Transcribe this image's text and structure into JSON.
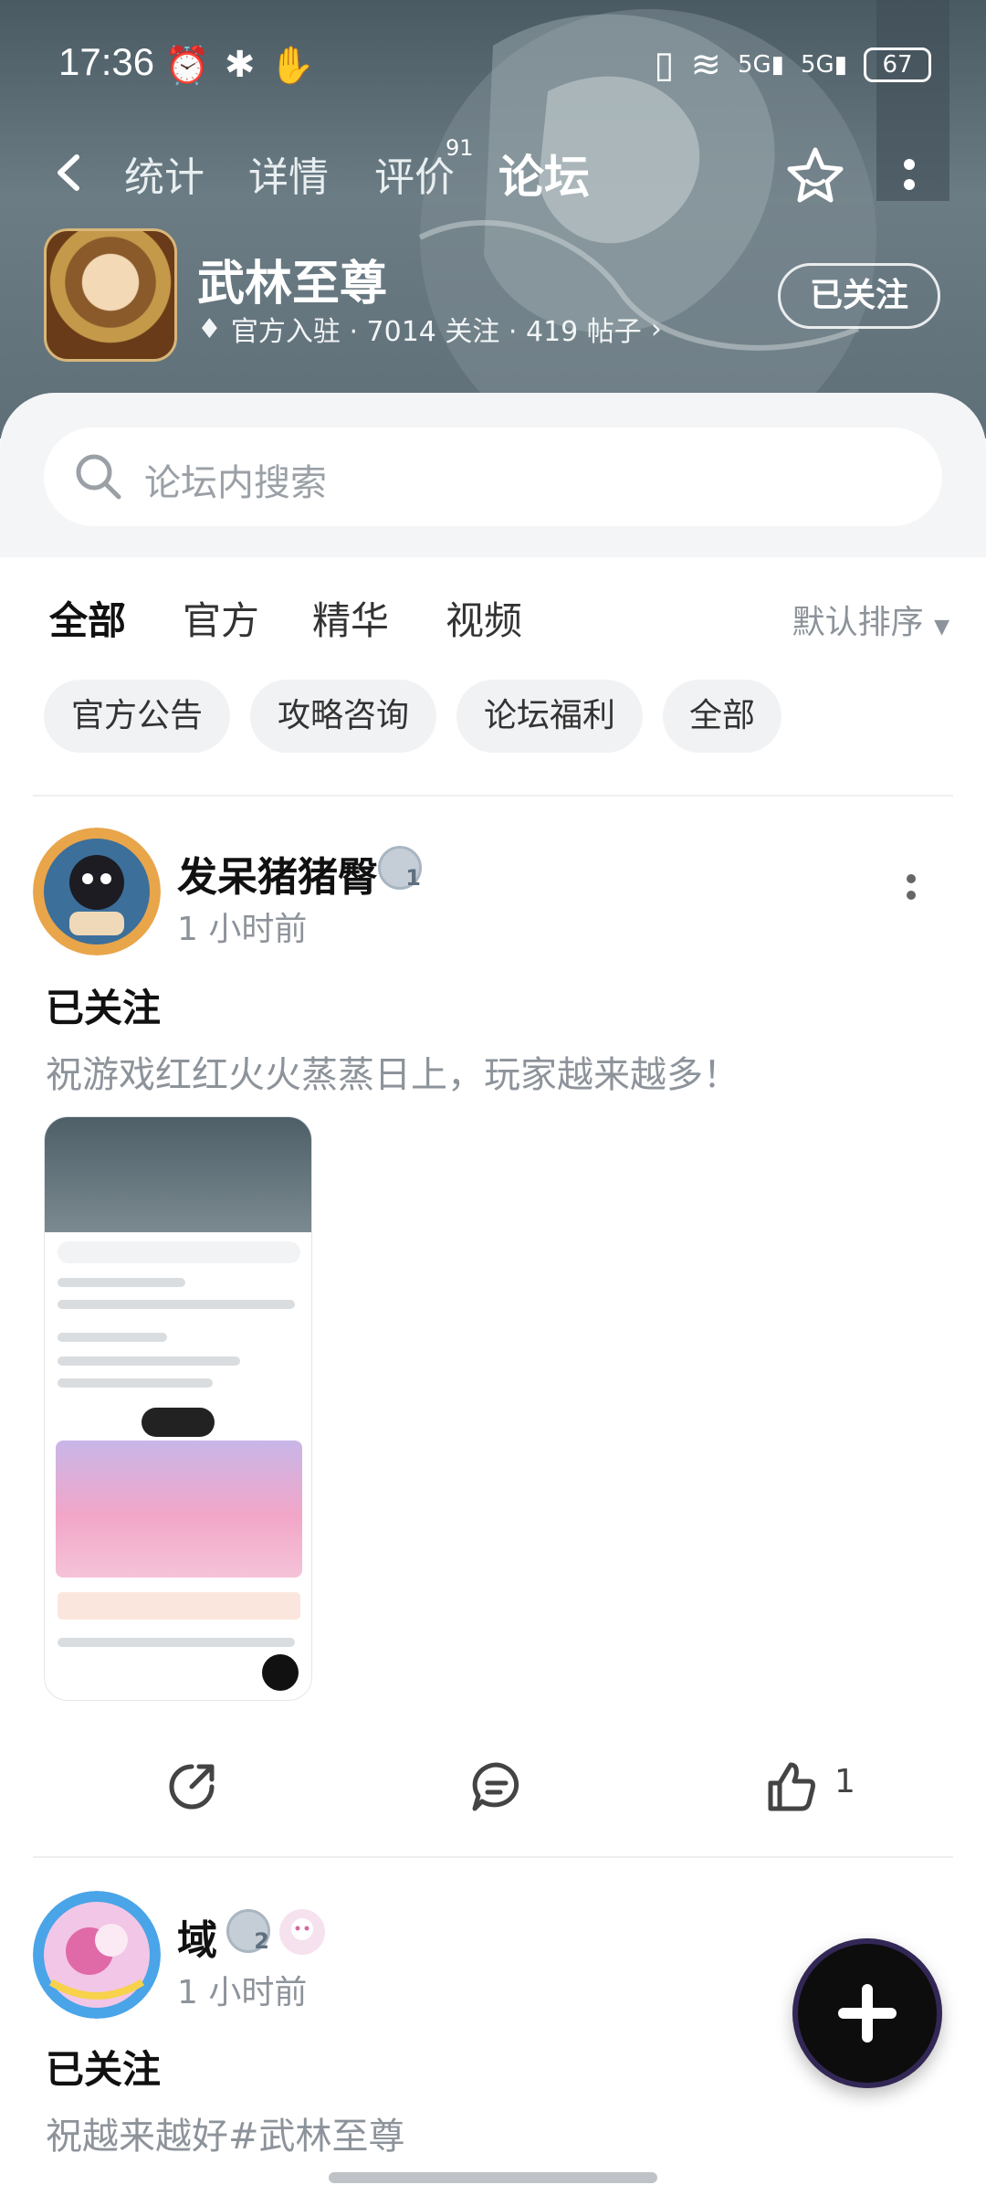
{
  "status_bar": {
    "time": "17:36",
    "battery": "67",
    "network": [
      "5G",
      "5G"
    ]
  },
  "nav": {
    "tabs": [
      {
        "label": "统计"
      },
      {
        "label": "详情"
      },
      {
        "label": "评价",
        "badge": "91"
      },
      {
        "label": "论坛",
        "active": true
      }
    ]
  },
  "game": {
    "name": "武林至尊",
    "meta": "官方入驻 · 7014 关注 · 419 帖子",
    "follow_label": "已关注"
  },
  "search": {
    "placeholder": "论坛内搜索"
  },
  "tabs": {
    "items": [
      "全部",
      "官方",
      "精华",
      "视频"
    ],
    "active": "全部",
    "sort_label": "默认排序"
  },
  "chips": [
    "官方公告",
    "攻略咨询",
    "论坛福利",
    "全部"
  ],
  "posts": [
    {
      "author": "发呆猪猪臀",
      "level": "1",
      "time": "1 小时前",
      "title": "已关注",
      "body": "祝游戏红红火火蒸蒸日上，玩家越来越多！",
      "likes": "1"
    },
    {
      "author": "域",
      "level": "2",
      "time": "1 小时前",
      "title": "已关注",
      "body": "祝越来越好#武林至尊"
    }
  ],
  "colors": {
    "accent": "#35d0b6",
    "banner": "#5f6f78",
    "muted": "#8d939a"
  }
}
